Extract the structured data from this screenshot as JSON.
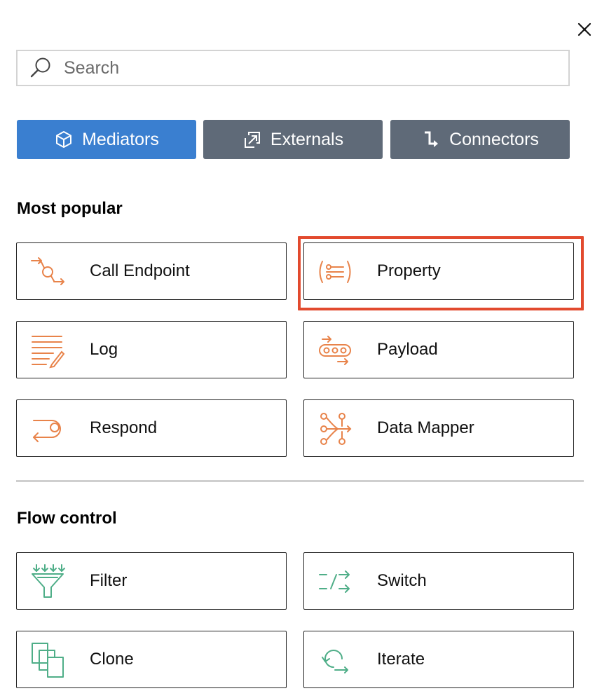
{
  "search": {
    "placeholder": "Search",
    "value": ""
  },
  "tabs": [
    {
      "label": "Mediators",
      "icon": "cube-icon",
      "active": true,
      "color": "#3a7fd0"
    },
    {
      "label": "Externals",
      "icon": "external-link-icon",
      "active": false,
      "color": "#5f6a78"
    },
    {
      "label": "Connectors",
      "icon": "connector-arrow-icon",
      "active": false,
      "color": "#5f6a78"
    }
  ],
  "sections": {
    "popular": {
      "title": "Most popular",
      "accent": "#e8834a",
      "items": [
        {
          "label": "Call Endpoint",
          "icon": "call-endpoint-icon"
        },
        {
          "label": "Property",
          "icon": "property-icon",
          "highlighted": true
        },
        {
          "label": "Log",
          "icon": "log-icon"
        },
        {
          "label": "Payload",
          "icon": "payload-icon"
        },
        {
          "label": "Respond",
          "icon": "respond-icon"
        },
        {
          "label": "Data Mapper",
          "icon": "data-mapper-icon"
        }
      ]
    },
    "flow": {
      "title": "Flow control",
      "accent": "#4fae88",
      "items": [
        {
          "label": "Filter",
          "icon": "filter-icon"
        },
        {
          "label": "Switch",
          "icon": "switch-icon"
        },
        {
          "label": "Clone",
          "icon": "clone-icon"
        },
        {
          "label": "Iterate",
          "icon": "iterate-icon"
        }
      ]
    }
  },
  "highlight_color": "#e24a2e"
}
